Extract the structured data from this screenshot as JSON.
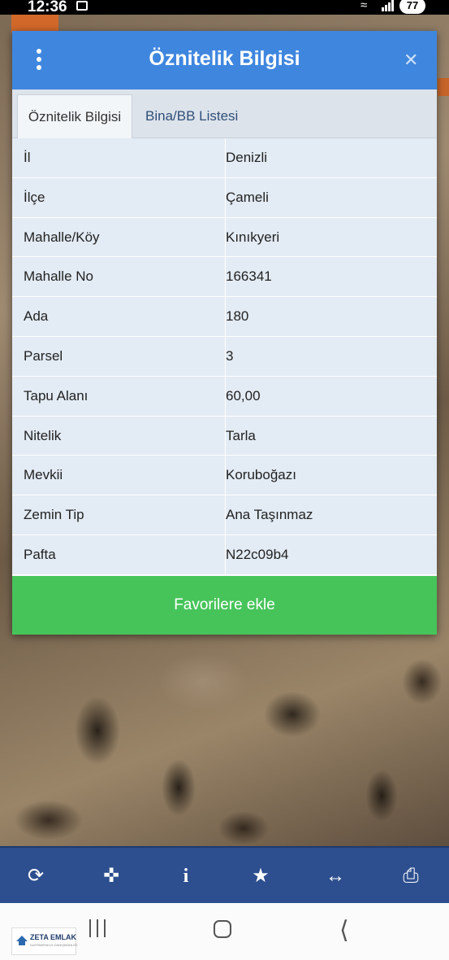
{
  "status_bar": {
    "time": "12:36",
    "battery": "77"
  },
  "dialog": {
    "title": "Öznitelik Bilgisi",
    "tabs": [
      {
        "label": "Öznitelik Bilgisi",
        "active": true
      },
      {
        "label": "Bina/BB Listesi",
        "active": false
      }
    ],
    "rows": [
      {
        "key": "İl",
        "value": "Denizli"
      },
      {
        "key": "İlçe",
        "value": "Çameli"
      },
      {
        "key": "Mahalle/Köy",
        "value": "Kınıkyeri"
      },
      {
        "key": "Mahalle No",
        "value": "166341"
      },
      {
        "key": "Ada",
        "value": "180"
      },
      {
        "key": "Parsel",
        "value": "3"
      },
      {
        "key": "Tapu Alanı",
        "value": "60,00"
      },
      {
        "key": "Nitelik",
        "value": "Tarla"
      },
      {
        "key": "Mevkii",
        "value": "Koruboğazı"
      },
      {
        "key": "Zemin Tip",
        "value": "Ana Taşınmaz"
      },
      {
        "key": "Pafta",
        "value": "N22c09b4"
      }
    ],
    "favorite_button": "Favorilere ekle"
  },
  "toolbar": {
    "icons": [
      "refresh-icon",
      "locate-icon",
      "info-icon",
      "star-icon",
      "measure-icon",
      "print-icon"
    ]
  },
  "watermark_logo": {
    "name": "ZETA EMLAK",
    "tagline": "GAYRİMENKUL DANIŞMANLIĞI"
  },
  "colors": {
    "header": "#3f86df",
    "favorite_button": "#46c45a",
    "toolbar": "#2d4f8f"
  }
}
